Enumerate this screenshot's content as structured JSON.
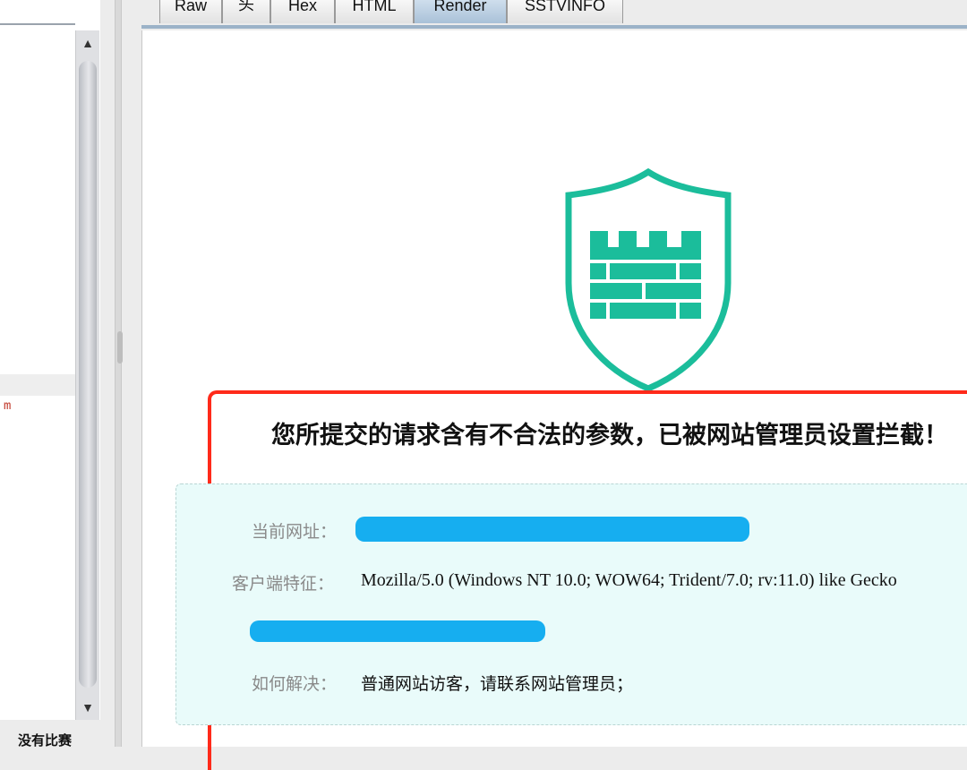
{
  "tabs": [
    {
      "label": "Raw",
      "active": false
    },
    {
      "label": "头",
      "active": false
    },
    {
      "label": "Hex",
      "active": false
    },
    {
      "label": "HTML",
      "active": false
    },
    {
      "label": "Render",
      "active": true
    },
    {
      "label": "SSTVINFO",
      "active": false
    }
  ],
  "left_pane": {
    "red_text": "m",
    "bottom_text": "没有比赛",
    "scroll_up_icon": "▲",
    "scroll_down_icon": "▼"
  },
  "block_page": {
    "headline": "您所提交的请求含有不合法的参数，已被网站管理员设置拦截！",
    "rows": {
      "url_label": "当前网址：",
      "client_label": "客户端特征：",
      "client_value": "Mozilla/5.0 (Windows NT 10.0; WOW64; Trident/7.0; rv:11.0) like Gecko",
      "solve_label": "如何解决：",
      "solve_value": "普通网站访客，请联系网站管理员；"
    },
    "colors": {
      "shield": "#1bbd9b",
      "card_border": "#ff2a1a",
      "redaction": "#16aef0",
      "info_bg": "#e9fbfa"
    },
    "icon": "firewall-shield-icon"
  }
}
